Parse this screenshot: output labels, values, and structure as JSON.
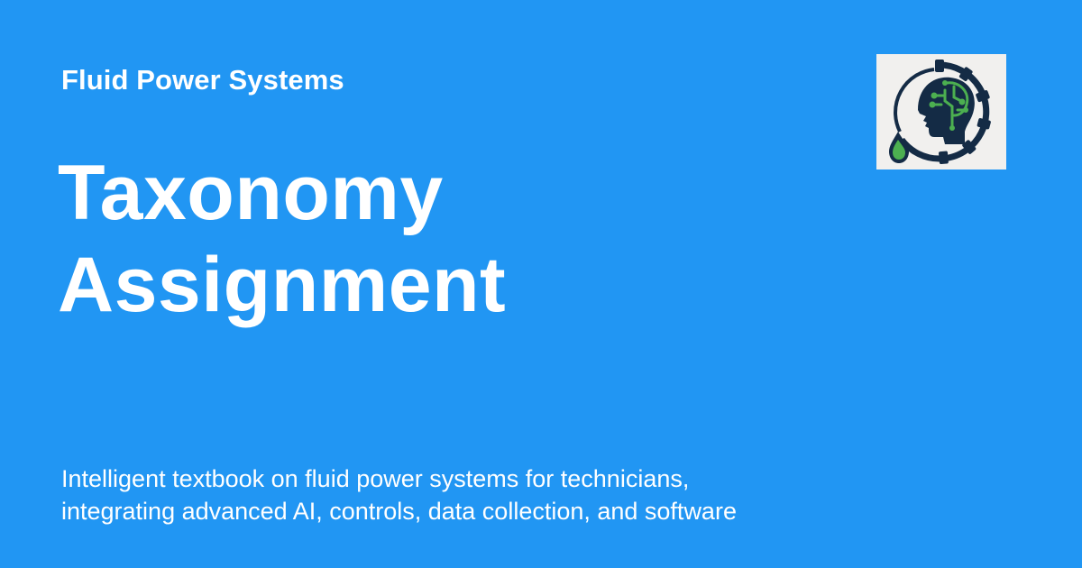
{
  "site": {
    "name": "Fluid Power Systems"
  },
  "page": {
    "title_lines": [
      "Taxonomy",
      "Assignment"
    ],
    "description_lines": [
      "Intelligent textbook on fluid power systems for technicians,",
      "integrating advanced AI, controls, data collection, and software"
    ]
  },
  "logo": {
    "icon": "gear-head-droplet-logo",
    "colors": {
      "background": "#f1f0ee",
      "navy": "#142b45",
      "green": "#4caf50"
    }
  },
  "colors": {
    "background": "#2196f3",
    "text": "#ffffff"
  }
}
